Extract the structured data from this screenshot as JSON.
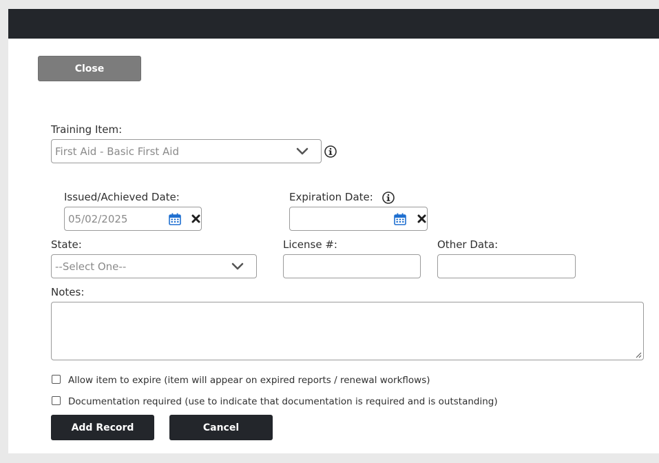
{
  "buttons": {
    "close": "Close",
    "add_record": "Add Record",
    "cancel": "Cancel"
  },
  "training_item": {
    "label": "Training Item:",
    "value": "First Aid - Basic First Aid"
  },
  "issued_date": {
    "label": "Issued/Achieved Date:",
    "value": "05/02/2025"
  },
  "expiration_date": {
    "label": "Expiration Date:",
    "value": ""
  },
  "state": {
    "label": "State:",
    "value": "--Select One--"
  },
  "license": {
    "label": "License #:",
    "value": ""
  },
  "other_data": {
    "label": "Other Data:",
    "value": ""
  },
  "notes": {
    "label": "Notes:",
    "value": ""
  },
  "checkboxes": {
    "allow_expire": {
      "label": "Allow item to expire (item will appear on expired reports / renewal workflows)",
      "checked": false
    },
    "documentation": {
      "label": "Documentation required (use to indicate that documentation is required and is outstanding)",
      "checked": false
    }
  },
  "colors": {
    "topbar": "#23262b",
    "close_button": "#7c7c7c",
    "calendar_icon": "#1e6fd0"
  },
  "icons": {
    "info": "info-icon",
    "calendar": "calendar-icon",
    "clear": "clear-x-icon",
    "dropdown": "chevron-down-icon"
  }
}
